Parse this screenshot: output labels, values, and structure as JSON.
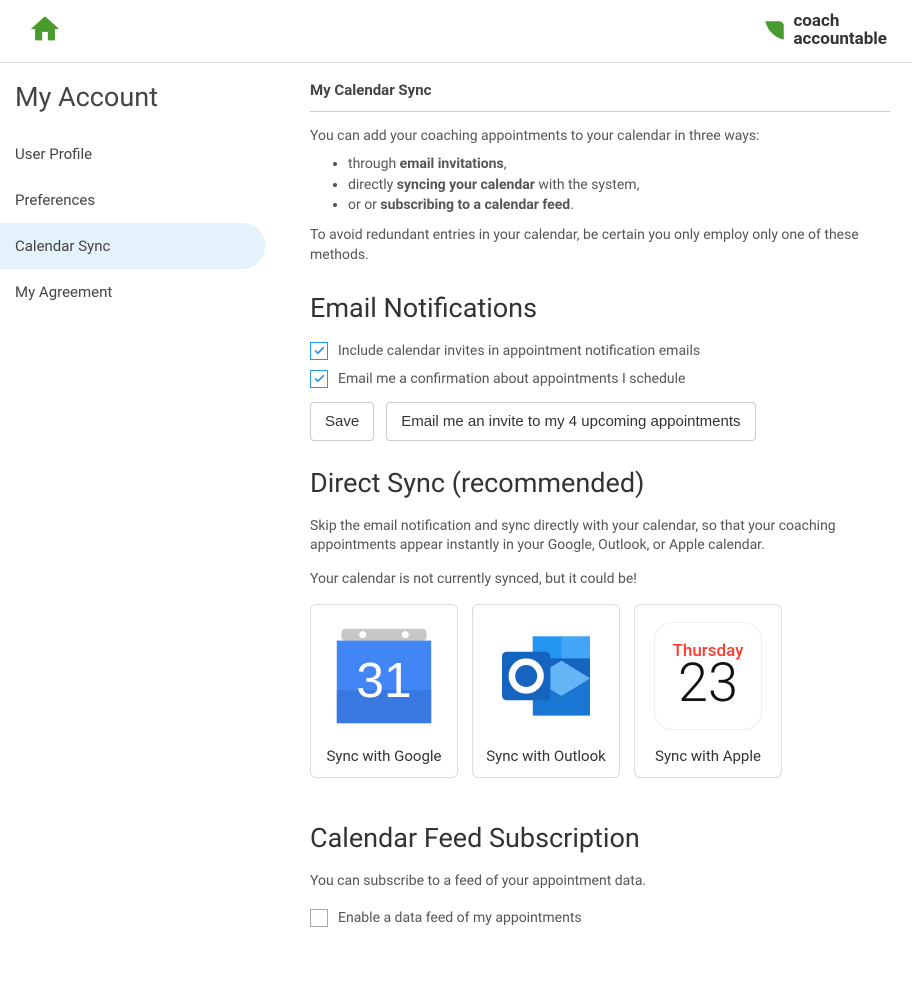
{
  "header": {
    "logo_line1": "coach",
    "logo_line2": "accountable"
  },
  "sidebar": {
    "page_title": "My Account",
    "items": [
      {
        "label": "User Profile",
        "active": false
      },
      {
        "label": "Preferences",
        "active": false
      },
      {
        "label": "Calendar Sync",
        "active": true
      },
      {
        "label": "My Agreement",
        "active": false
      }
    ]
  },
  "main": {
    "heading": "My Calendar Sync",
    "intro_text": "You can add your coaching appointments to your calendar in three ways:",
    "intro_bullets": {
      "b1_pre": "through ",
      "b1_bold": "email invitations",
      "b1_post": ",",
      "b2_pre": "directly ",
      "b2_bold": "syncing your calendar",
      "b2_post": " with the system,",
      "b3_pre": "or or ",
      "b3_bold": "subscribing to a calendar feed",
      "b3_post": "."
    },
    "intro_warning": "To avoid redundant entries in your calendar, be certain you only employ only one of these methods.",
    "email_section": {
      "title": "Email Notifications",
      "cb1_label": "Include calendar invites in appointment notification emails",
      "cb1_checked": true,
      "cb2_label": "Email me a confirmation about appointments I schedule",
      "cb2_checked": true,
      "save_label": "Save",
      "invite_label": "Email me an invite to my 4 upcoming appointments"
    },
    "direct_section": {
      "title": "Direct Sync (recommended)",
      "desc": "Skip the email notification and sync directly with your calendar, so that your coaching appointments appear instantly in your Google, Outlook, or Apple calendar.",
      "status": "Your calendar is not currently synced, but it could be!",
      "google_label": "Sync with Google",
      "outlook_label": "Sync with Outlook",
      "apple_label": "Sync with Apple",
      "apple_day": "Thursday",
      "apple_date": "23",
      "google_date": "31"
    },
    "feed_section": {
      "title": "Calendar Feed Subscription",
      "desc": "You can subscribe to a feed of your appointment data.",
      "cb_label": "Enable a data feed of my appointments",
      "cb_checked": false
    }
  }
}
